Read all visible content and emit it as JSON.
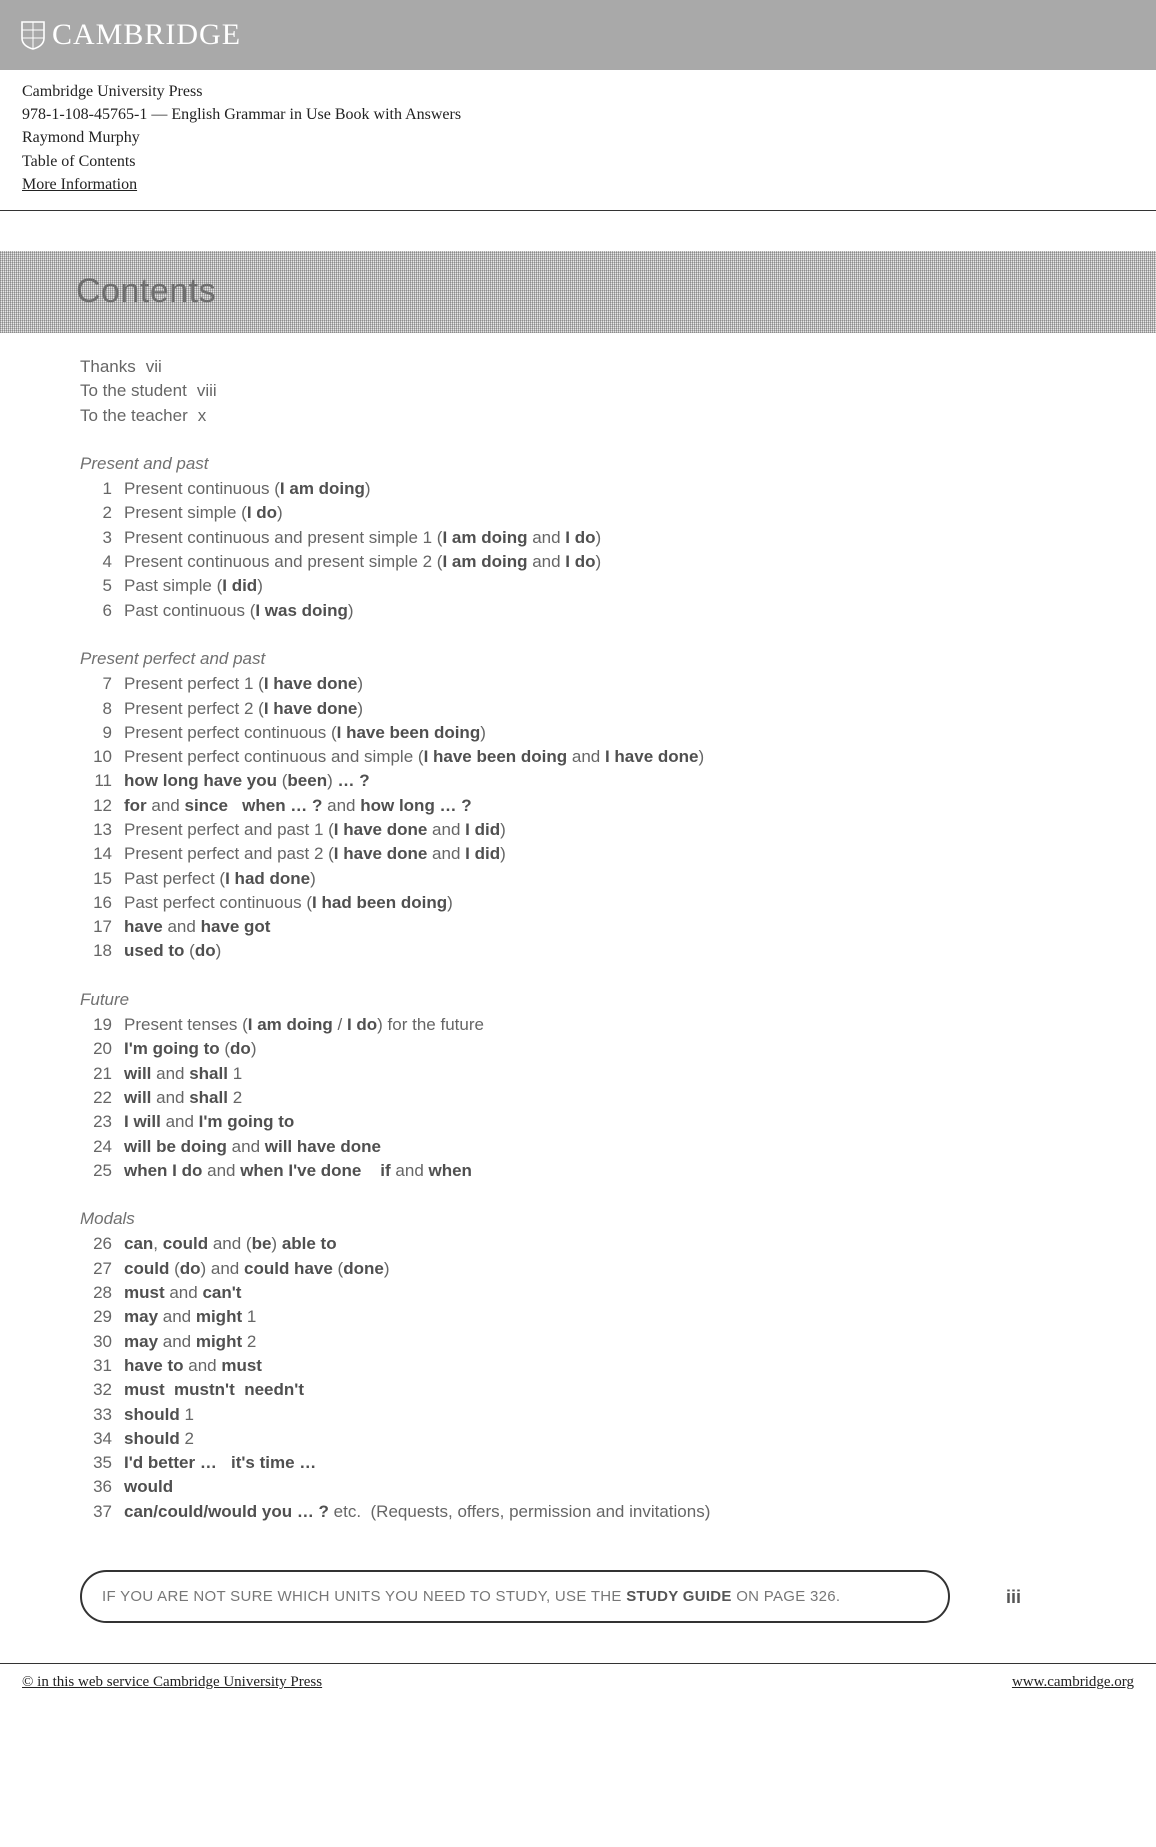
{
  "brand": "CAMBRIDGE",
  "meta": {
    "publisher": "Cambridge University Press",
    "isbn_line": "978-1-108-45765-1 — English Grammar in Use  Book with Answers",
    "author": "Raymond Murphy",
    "section": "Table of Contents",
    "more": "More Information"
  },
  "contents_title": "Contents",
  "intro": [
    {
      "label": "Thanks",
      "page": "vii"
    },
    {
      "label": "To the student",
      "page": "viii"
    },
    {
      "label": "To the teacher",
      "page": "x"
    }
  ],
  "sections": [
    {
      "title": "Present and past",
      "items": [
        {
          "n": "1",
          "html": "Present continuous (<b>I am doing</b>)"
        },
        {
          "n": "2",
          "html": "Present simple (<b>I do</b>)"
        },
        {
          "n": "3",
          "html": "Present continuous and present simple 1 (<b>I am doing</b> and <b>I do</b>)"
        },
        {
          "n": "4",
          "html": "Present continuous and present simple 2 (<b>I am doing</b> and <b>I do</b>)"
        },
        {
          "n": "5",
          "html": "Past simple (<b>I did</b>)"
        },
        {
          "n": "6",
          "html": "Past continuous (<b>I was doing</b>)"
        }
      ]
    },
    {
      "title": "Present perfect and past",
      "items": [
        {
          "n": "7",
          "html": "Present perfect 1 (<b>I have done</b>)"
        },
        {
          "n": "8",
          "html": "Present perfect 2 (<b>I have done</b>)"
        },
        {
          "n": "9",
          "html": "Present perfect continuous (<b>I have been doing</b>)"
        },
        {
          "n": "10",
          "html": "Present perfect continuous and simple (<b>I have been doing</b> and <b>I have done</b>)"
        },
        {
          "n": "11",
          "html": "<b>how long have you</b> (<b>been</b>) <b>… ?</b>"
        },
        {
          "n": "12",
          "html": "<b>for</b> and <b>since</b>&nbsp;&nbsp;&nbsp;<b>when … ?</b> and <b>how long … ?</b>"
        },
        {
          "n": "13",
          "html": "Present perfect and past 1 (<b>I have done</b> and <b>I did</b>)"
        },
        {
          "n": "14",
          "html": "Present perfect and past 2 (<b>I have done</b> and <b>I did</b>)"
        },
        {
          "n": "15",
          "html": "Past perfect (<b>I had done</b>)"
        },
        {
          "n": "16",
          "html": "Past perfect continuous (<b>I had been doing</b>)"
        },
        {
          "n": "17",
          "html": "<b>have</b> and <b>have got</b>"
        },
        {
          "n": "18",
          "html": "<b>used to</b> (<b>do</b>)"
        }
      ]
    },
    {
      "title": "Future",
      "items": [
        {
          "n": "19",
          "html": "Present tenses (<b>I am doing</b> / <b>I do</b>) for the future"
        },
        {
          "n": "20",
          "html": "<b>I'm going to</b> (<b>do</b>)"
        },
        {
          "n": "21",
          "html": "<b>will</b> and <b>shall</b> 1"
        },
        {
          "n": "22",
          "html": "<b>will</b> and <b>shall</b> 2"
        },
        {
          "n": "23",
          "html": "<b>I will</b> and <b>I'm going to</b>"
        },
        {
          "n": "24",
          "html": "<b>will be doing</b> and <b>will have done</b>"
        },
        {
          "n": "25",
          "html": "<b>when I do</b> and <b>when I've done</b>&nbsp;&nbsp;&nbsp;&nbsp;<b>if</b> and <b>when</b>"
        }
      ]
    },
    {
      "title": "Modals",
      "items": [
        {
          "n": "26",
          "html": "<b>can</b>, <b>could</b> and (<b>be</b>) <b>able to</b>"
        },
        {
          "n": "27",
          "html": "<b>could</b> (<b>do</b>) and <b>could have</b> (<b>done</b>)"
        },
        {
          "n": "28",
          "html": "<b>must</b> and <b>can't</b>"
        },
        {
          "n": "29",
          "html": "<b>may</b> and <b>might</b> 1"
        },
        {
          "n": "30",
          "html": "<b>may</b> and <b>might</b> 2"
        },
        {
          "n": "31",
          "html": "<b>have to</b> and <b>must</b>"
        },
        {
          "n": "32",
          "html": "<b>must&nbsp;&nbsp;mustn't&nbsp;&nbsp;needn't</b>"
        },
        {
          "n": "33",
          "html": "<b>should</b> 1"
        },
        {
          "n": "34",
          "html": "<b>should</b> 2"
        },
        {
          "n": "35",
          "html": "<b>I'd better …&nbsp;&nbsp;&nbsp;it's time …</b>"
        },
        {
          "n": "36",
          "html": "<b>would</b>"
        },
        {
          "n": "37",
          "html": "<b>can/could/would you … ?</b> etc.&nbsp;&nbsp;(Requests, offers, permission and invitations)"
        }
      ]
    }
  ],
  "study_guide": {
    "pre": "IF YOU ARE NOT SURE WHICH UNITS YOU NEED TO STUDY, USE THE ",
    "bold": "STUDY GUIDE",
    "post": " ON PAGE 326."
  },
  "page_number": "iii",
  "footer": {
    "left": "© in this web service Cambridge University Press",
    "right": "www.cambridge.org"
  }
}
